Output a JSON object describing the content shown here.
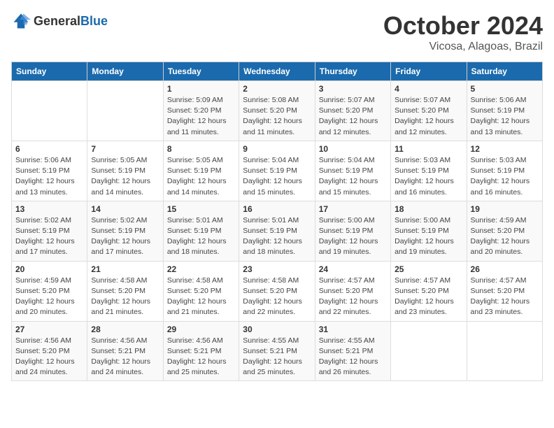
{
  "header": {
    "logo_general": "General",
    "logo_blue": "Blue",
    "title": "October 2024",
    "location": "Vicosa, Alagoas, Brazil"
  },
  "days_of_week": [
    "Sunday",
    "Monday",
    "Tuesday",
    "Wednesday",
    "Thursday",
    "Friday",
    "Saturday"
  ],
  "weeks": [
    [
      {
        "day": "",
        "info": ""
      },
      {
        "day": "",
        "info": ""
      },
      {
        "day": "1",
        "info": "Sunrise: 5:09 AM\nSunset: 5:20 PM\nDaylight: 12 hours\nand 11 minutes."
      },
      {
        "day": "2",
        "info": "Sunrise: 5:08 AM\nSunset: 5:20 PM\nDaylight: 12 hours\nand 11 minutes."
      },
      {
        "day": "3",
        "info": "Sunrise: 5:07 AM\nSunset: 5:20 PM\nDaylight: 12 hours\nand 12 minutes."
      },
      {
        "day": "4",
        "info": "Sunrise: 5:07 AM\nSunset: 5:20 PM\nDaylight: 12 hours\nand 12 minutes."
      },
      {
        "day": "5",
        "info": "Sunrise: 5:06 AM\nSunset: 5:19 PM\nDaylight: 12 hours\nand 13 minutes."
      }
    ],
    [
      {
        "day": "6",
        "info": "Sunrise: 5:06 AM\nSunset: 5:19 PM\nDaylight: 12 hours\nand 13 minutes."
      },
      {
        "day": "7",
        "info": "Sunrise: 5:05 AM\nSunset: 5:19 PM\nDaylight: 12 hours\nand 14 minutes."
      },
      {
        "day": "8",
        "info": "Sunrise: 5:05 AM\nSunset: 5:19 PM\nDaylight: 12 hours\nand 14 minutes."
      },
      {
        "day": "9",
        "info": "Sunrise: 5:04 AM\nSunset: 5:19 PM\nDaylight: 12 hours\nand 15 minutes."
      },
      {
        "day": "10",
        "info": "Sunrise: 5:04 AM\nSunset: 5:19 PM\nDaylight: 12 hours\nand 15 minutes."
      },
      {
        "day": "11",
        "info": "Sunrise: 5:03 AM\nSunset: 5:19 PM\nDaylight: 12 hours\nand 16 minutes."
      },
      {
        "day": "12",
        "info": "Sunrise: 5:03 AM\nSunset: 5:19 PM\nDaylight: 12 hours\nand 16 minutes."
      }
    ],
    [
      {
        "day": "13",
        "info": "Sunrise: 5:02 AM\nSunset: 5:19 PM\nDaylight: 12 hours\nand 17 minutes."
      },
      {
        "day": "14",
        "info": "Sunrise: 5:02 AM\nSunset: 5:19 PM\nDaylight: 12 hours\nand 17 minutes."
      },
      {
        "day": "15",
        "info": "Sunrise: 5:01 AM\nSunset: 5:19 PM\nDaylight: 12 hours\nand 18 minutes."
      },
      {
        "day": "16",
        "info": "Sunrise: 5:01 AM\nSunset: 5:19 PM\nDaylight: 12 hours\nand 18 minutes."
      },
      {
        "day": "17",
        "info": "Sunrise: 5:00 AM\nSunset: 5:19 PM\nDaylight: 12 hours\nand 19 minutes."
      },
      {
        "day": "18",
        "info": "Sunrise: 5:00 AM\nSunset: 5:19 PM\nDaylight: 12 hours\nand 19 minutes."
      },
      {
        "day": "19",
        "info": "Sunrise: 4:59 AM\nSunset: 5:20 PM\nDaylight: 12 hours\nand 20 minutes."
      }
    ],
    [
      {
        "day": "20",
        "info": "Sunrise: 4:59 AM\nSunset: 5:20 PM\nDaylight: 12 hours\nand 20 minutes."
      },
      {
        "day": "21",
        "info": "Sunrise: 4:58 AM\nSunset: 5:20 PM\nDaylight: 12 hours\nand 21 minutes."
      },
      {
        "day": "22",
        "info": "Sunrise: 4:58 AM\nSunset: 5:20 PM\nDaylight: 12 hours\nand 21 minutes."
      },
      {
        "day": "23",
        "info": "Sunrise: 4:58 AM\nSunset: 5:20 PM\nDaylight: 12 hours\nand 22 minutes."
      },
      {
        "day": "24",
        "info": "Sunrise: 4:57 AM\nSunset: 5:20 PM\nDaylight: 12 hours\nand 22 minutes."
      },
      {
        "day": "25",
        "info": "Sunrise: 4:57 AM\nSunset: 5:20 PM\nDaylight: 12 hours\nand 23 minutes."
      },
      {
        "day": "26",
        "info": "Sunrise: 4:57 AM\nSunset: 5:20 PM\nDaylight: 12 hours\nand 23 minutes."
      }
    ],
    [
      {
        "day": "27",
        "info": "Sunrise: 4:56 AM\nSunset: 5:20 PM\nDaylight: 12 hours\nand 24 minutes."
      },
      {
        "day": "28",
        "info": "Sunrise: 4:56 AM\nSunset: 5:21 PM\nDaylight: 12 hours\nand 24 minutes."
      },
      {
        "day": "29",
        "info": "Sunrise: 4:56 AM\nSunset: 5:21 PM\nDaylight: 12 hours\nand 25 minutes."
      },
      {
        "day": "30",
        "info": "Sunrise: 4:55 AM\nSunset: 5:21 PM\nDaylight: 12 hours\nand 25 minutes."
      },
      {
        "day": "31",
        "info": "Sunrise: 4:55 AM\nSunset: 5:21 PM\nDaylight: 12 hours\nand 26 minutes."
      },
      {
        "day": "",
        "info": ""
      },
      {
        "day": "",
        "info": ""
      }
    ]
  ]
}
